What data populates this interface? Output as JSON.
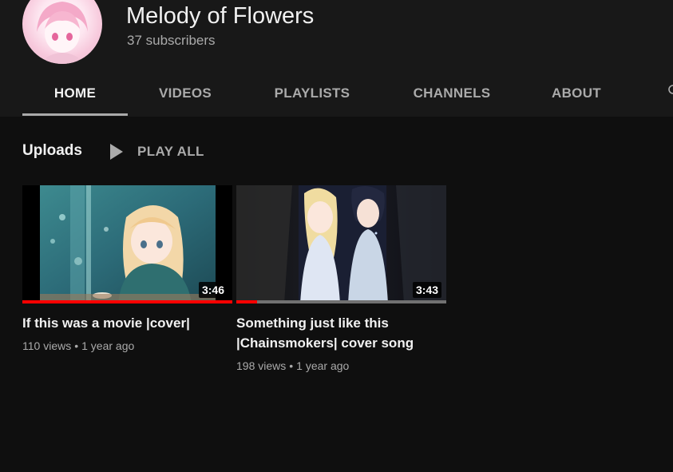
{
  "channel": {
    "name": "Melody of Flowers",
    "subscribers": "37 subscribers"
  },
  "tabs": [
    {
      "label": "HOME",
      "active": true
    },
    {
      "label": "VIDEOS",
      "active": false
    },
    {
      "label": "PLAYLISTS",
      "active": false
    },
    {
      "label": "CHANNELS",
      "active": false
    },
    {
      "label": "ABOUT",
      "active": false
    }
  ],
  "section": {
    "title": "Uploads",
    "play_all": "PLAY ALL"
  },
  "videos": [
    {
      "title": "If this was a movie |cover|",
      "duration": "3:46",
      "views": "110 views",
      "age": "1 year ago",
      "watched_fraction": 1.0
    },
    {
      "title": "Something just like this |Chainsmokers| cover song",
      "duration": "3:43",
      "views": "198 views",
      "age": "1 year ago",
      "watched_fraction": 0.1
    }
  ],
  "meta_separator": "•",
  "colors": {
    "background": "#0f0f0f",
    "header": "#181818",
    "progress": "#ff0000",
    "muted_text": "#aaaaaa"
  },
  "icons": {
    "play_all": "play-icon",
    "tab_search": "search-icon"
  }
}
